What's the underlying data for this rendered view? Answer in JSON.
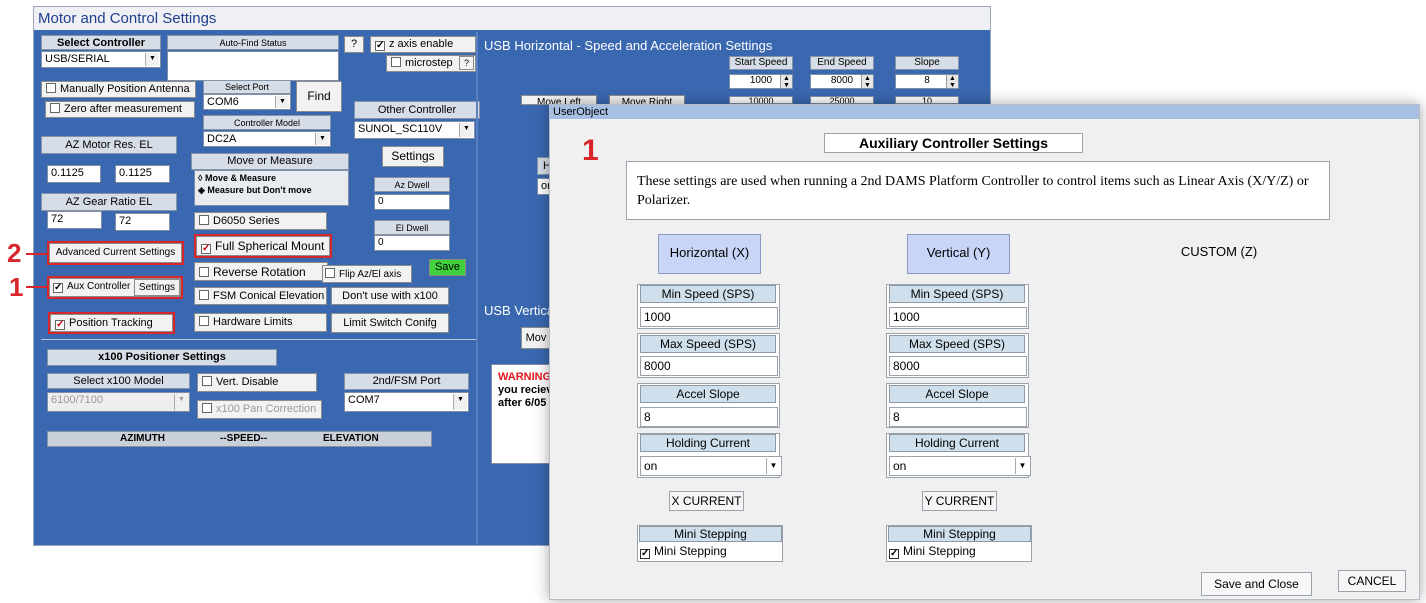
{
  "main": {
    "title": "Motor and Control Settings",
    "select_controller": {
      "label": "Select Controller",
      "value": "USB/SERIAL"
    },
    "auto_find_status": "Auto-Find Status",
    "help": "?",
    "z_axis": "z axis enable",
    "microstep": "microstep",
    "microstep_help": "?",
    "manually_position": "Manually Position Antenna",
    "zero_after": "Zero after measurement",
    "select_port": {
      "label": "Select Port",
      "value": "COM6"
    },
    "find": "Find",
    "controller_model": {
      "label": "Controller Model",
      "value": "DC2A"
    },
    "other_controller": {
      "label": "Other Controller",
      "value": "SUNOL_SC110V"
    },
    "settings": "Settings",
    "motor_res": {
      "label": "AZ  Motor Res.  EL",
      "az": "0.1125",
      "el": "0.1125"
    },
    "move_or_measure": {
      "label": "Move or Measure",
      "opt1": "Move & Measure",
      "opt2": "Measure but Don't move"
    },
    "az_dwell": {
      "label": "Az Dwell",
      "value": "0"
    },
    "gear_ratio": {
      "label": "AZ   Gear Ratio  EL",
      "az": "72",
      "el": "72"
    },
    "d6050": "D6050 Series",
    "el_dwell": {
      "label": "El Dwell",
      "value": "0"
    },
    "advanced_current": "Advanced Current Settings",
    "full_spherical": "Full Spherical Mount",
    "reverse_rotation": "Reverse Rotation",
    "flip": "Flip Az/El axis",
    "save": "Save",
    "aux_controller": "Aux Controller",
    "aux_settings": "Settings",
    "fsm_conical": "FSM Conical Elevation",
    "dont_use": "Don't use with x100",
    "position_tracking": "Position Tracking",
    "hardware_limits": "Hardware Limits",
    "limit_switch": "Limit Switch Conifg",
    "x100_title": "x100 Positioner Settings",
    "select_x100": {
      "label": "Select x100 Model",
      "value": "6100/7100"
    },
    "vert_disable": "Vert. Disable",
    "pan_correction": "x100 Pan Correction",
    "fsm_port": {
      "label": "2nd/FSM Port",
      "value": "COM7"
    },
    "azimuth": "AZIMUTH",
    "speed": "--SPEED--",
    "elevation": "ELEVATION",
    "usb_h_title": "USB Horizontal - Speed and Acceleration Settings",
    "start_speed": {
      "label": "Start Speed",
      "value": "1000",
      "sub": "10000"
    },
    "end_speed": {
      "label": "End Speed",
      "value": "8000",
      "sub": "25000"
    },
    "slope": {
      "label": "Slope",
      "value": "8",
      "sub": "10"
    },
    "move_left": "Move Left",
    "move_right": "Move Right",
    "h_partial": "H",
    "on_partial": "on",
    "usb_v_title": "USB Vertical",
    "mo_partial": "Mov",
    "warning": "WARNING",
    "warn_line2": "you reciev",
    "warn_line3": "after 6/05"
  },
  "callouts": {
    "one": "1",
    "two": "2",
    "three": "1"
  },
  "dialog": {
    "titlebar": "UserObject",
    "heading": "Auxiliary Controller Settings",
    "description": "These settings are used when running a 2nd DAMS Platform Controller to control items such as Linear Axis (X/Y/Z) or Polarizer.",
    "axes": [
      {
        "title": "Horizontal (X)",
        "min_label": "Min Speed (SPS)",
        "min": "1000",
        "max_label": "Max Speed (SPS)",
        "max": "8000",
        "accel_label": "Accel Slope",
        "accel": "8",
        "hold_label": "Holding Current",
        "hold": "on",
        "current_btn": "X CURRENT",
        "mini_label": "Mini Stepping",
        "mini": "Mini Stepping"
      },
      {
        "title": "Vertical (Y)",
        "min_label": "Min Speed (SPS)",
        "min": "1000",
        "max_label": "Max Speed (SPS)",
        "max": "8000",
        "accel_label": "Accel Slope",
        "accel": "8",
        "hold_label": "Holding Current",
        "hold": "on",
        "current_btn": "Y CURRENT",
        "mini_label": "Mini Stepping",
        "mini": "Mini Stepping"
      }
    ],
    "custom": "CUSTOM (Z)",
    "save_close": "Save and Close",
    "cancel": "CANCEL"
  }
}
